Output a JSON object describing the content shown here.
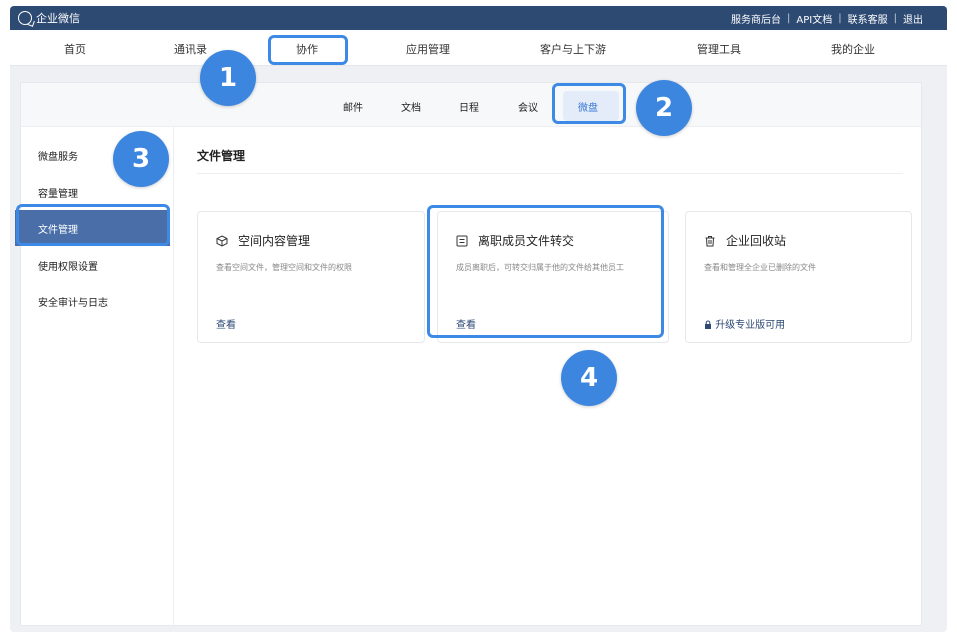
{
  "topbar": {
    "app_name": "企业微信",
    "links": [
      "服务商后台",
      "API文档",
      "联系客服",
      "退出"
    ],
    "separator": "|"
  },
  "main_nav": [
    "首页",
    "通讯录",
    "协作",
    "应用管理",
    "客户与上下游",
    "管理工具",
    "我的企业"
  ],
  "sub_nav": [
    "邮件",
    "文档",
    "日程",
    "会议",
    "微盘"
  ],
  "sidebar": [
    "微盘服务",
    "容量管理",
    "文件管理",
    "使用权限设置",
    "安全审计与日志"
  ],
  "content": {
    "title": "文件管理",
    "cards": [
      {
        "icon": "cube-icon",
        "title": "空间内容管理",
        "desc": "查看空间文件，管理空间和文件的权限",
        "action": "查看"
      },
      {
        "icon": "transfer-icon",
        "title": "离职成员文件转交",
        "desc": "成员离职后，可转交归属于他的文件给其他员工",
        "action": "查看"
      },
      {
        "icon": "trash-icon",
        "title": "企业回收站",
        "desc": "查看和管理全企业已删除的文件",
        "action": "升级专业版可用",
        "action_icon": "lock-icon"
      }
    ]
  },
  "annotations": [
    "1",
    "2",
    "3",
    "4"
  ],
  "colors": {
    "topbar": "#2d4a73",
    "highlight": "#3d8ae6",
    "badge": "#3d86e0",
    "sidebar_active": "#4a6fa8"
  }
}
